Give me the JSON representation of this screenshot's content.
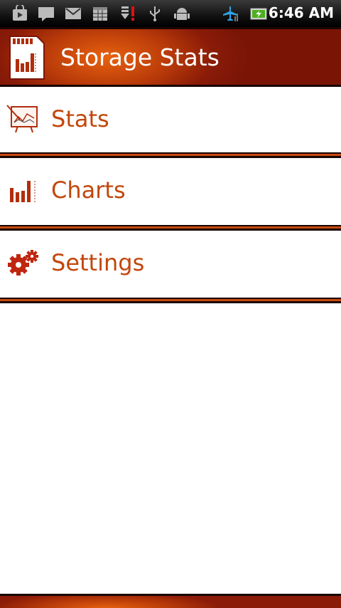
{
  "status_bar": {
    "time": "6:46 AM",
    "icons": [
      "market-icon",
      "message-icon",
      "gmail-icon",
      "calendar-icon",
      "download-alert-icon",
      "usb-icon",
      "android-debug-icon",
      "airplane-mode-icon",
      "battery-icon"
    ]
  },
  "header": {
    "title": "Storage Stats",
    "icon": "sd-card-chart-icon"
  },
  "menu": {
    "items": [
      {
        "label": "Stats",
        "icon": "stats-easel-icon"
      },
      {
        "label": "Charts",
        "icon": "bar-chart-icon"
      },
      {
        "label": "Settings",
        "icon": "gears-icon"
      }
    ]
  },
  "colors": {
    "accent": "#c2470b",
    "header_dark": "#7a1506",
    "header_light": "#e8620f"
  }
}
